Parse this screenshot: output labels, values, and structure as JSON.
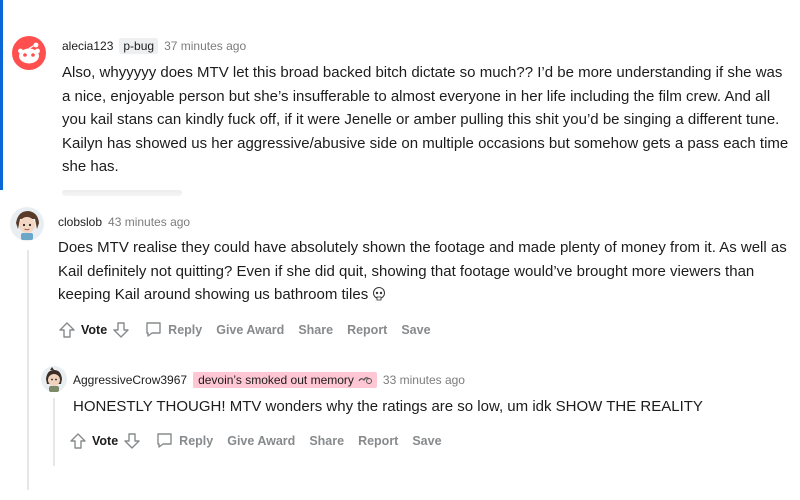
{
  "colors": {
    "accent_bar": "#0b66d8",
    "flair_pink": "#ffc7d4",
    "meta_gray": "#7c7c7c",
    "action_gray": "#878a8c"
  },
  "comments": [
    {
      "username": "alecia123",
      "flair": "p-bug",
      "timestamp": "37 minutes ago",
      "avatar_icon": "snoo-avatar-icon",
      "body": "Also, whyyyyy does MTV let this broad backed bitch dictate so much?? I’d be more understanding if she was a nice, enjoyable person but she’s insufferable to almost everyone in her life including the film crew. And all you kail stans can kindly fuck off, if it were Jenelle or amber pulling this shit you’d be singing a different tune. Kailyn has showed us her aggressive/abusive side on multiple occasions but somehow gets a pass each time she has."
    },
    {
      "username": "clobslob",
      "timestamp": "43 minutes ago",
      "avatar_icon": "girl-avatar-icon",
      "body": "Does MTV realise they could have absolutely shown the footage and made plenty of money from it. As well as Kail definitely not quitting? Even if she did quit, showing that footage would’ve brought more viewers than keeping Kail around showing us bathroom tiles",
      "emoji_icon": "skull-emoji-icon",
      "actions": {
        "vote": "Vote",
        "reply": "Reply",
        "give_award": "Give Award",
        "share": "Share",
        "report": "Report",
        "save": "Save"
      }
    },
    {
      "username": "AggressiveCrow3967",
      "flair": "devoin’s smoked out memory",
      "flair_icon": "smoke-emoji-icon",
      "timestamp": "33 minutes ago",
      "avatar_icon": "crow-avatar-icon",
      "body": "HONESTLY THOUGH! MTV wonders why the ratings are so low, um idk SHOW THE REALITY",
      "actions": {
        "vote": "Vote",
        "reply": "Reply",
        "give_award": "Give Award",
        "share": "Share",
        "report": "Report",
        "save": "Save"
      }
    }
  ]
}
